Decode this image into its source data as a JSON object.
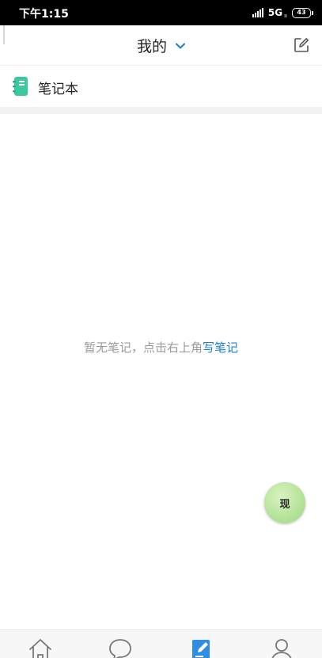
{
  "status_bar": {
    "time": "下午1:15",
    "network": "5G",
    "network_sub": "ıı",
    "battery": "43"
  },
  "header": {
    "title": "我的",
    "title_chevron_icon": "chevron-down-icon",
    "edit_icon": "edit-note-icon"
  },
  "notebook": {
    "icon": "notebook-icon",
    "label": "笔记本"
  },
  "empty_state": {
    "text": "暂无笔记，点击右上角",
    "link": "写笔记"
  },
  "fab": {
    "label": "现"
  },
  "bottom_nav": {
    "items": [
      {
        "icon": "home-icon"
      },
      {
        "icon": "chat-bubble-icon"
      },
      {
        "icon": "notes-icon"
      },
      {
        "icon": "profile-icon"
      }
    ]
  },
  "colors": {
    "accent": "#1e7fcf",
    "notebook_icon": "#3cc8a0",
    "fab": "#b7e49a"
  }
}
